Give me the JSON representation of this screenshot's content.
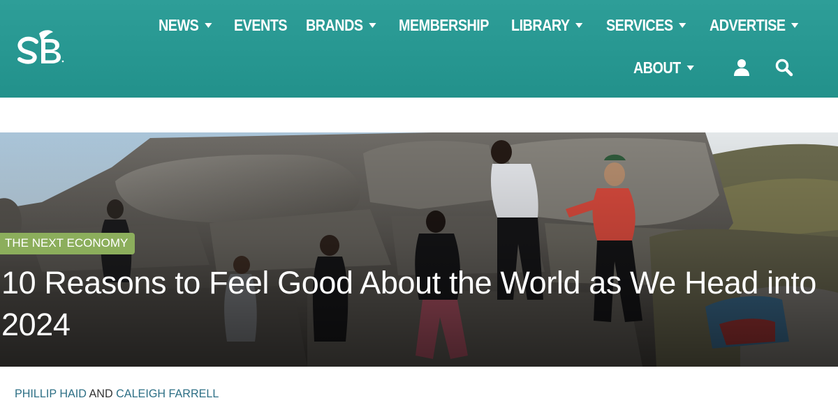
{
  "colors": {
    "header_bg": "#279791",
    "badge_bg": "#8cae5c",
    "author_link": "#2d6f85",
    "nav_text": "#ffffff"
  },
  "header": {
    "logo_text": "SB",
    "nav": [
      {
        "label": "NEWS",
        "has_dropdown": true
      },
      {
        "label": "EVENTS",
        "has_dropdown": false
      },
      {
        "label": "BRANDS",
        "has_dropdown": true
      },
      {
        "label": "MEMBERSHIP",
        "has_dropdown": false
      },
      {
        "label": "LIBRARY",
        "has_dropdown": true
      },
      {
        "label": "SERVICES",
        "has_dropdown": true
      },
      {
        "label": "ADVERTISE",
        "has_dropdown": true
      },
      {
        "label": "ABOUT",
        "has_dropdown": true
      }
    ],
    "icons": {
      "account": "user-icon",
      "search": "search-icon"
    }
  },
  "article": {
    "category": "THE NEXT ECONOMY",
    "title": "10 Reasons to Feel Good About the World as We Head into 2024",
    "byline": {
      "author_1": "PHILLIP HAID",
      "connector": "AND",
      "author_2": "CALEIGH FARRELL"
    },
    "hero_image": "group-of-people-climbing-boulders"
  }
}
